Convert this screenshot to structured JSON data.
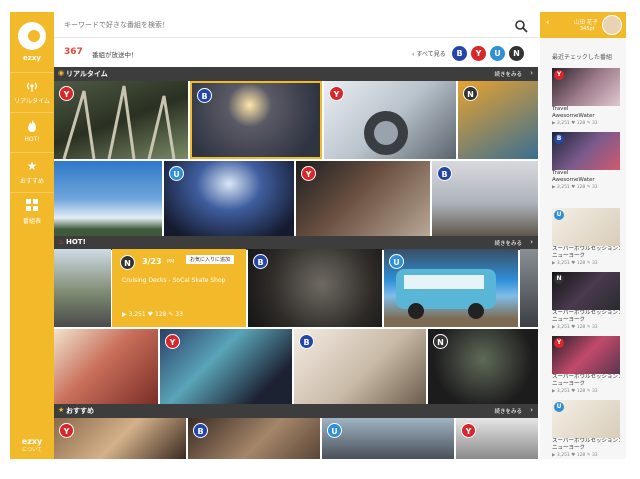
{
  "sidebar": {
    "logo_text": "ezxy",
    "items": [
      {
        "label": "リアルタイム",
        "icon": "broadcast-icon"
      },
      {
        "label": "HOT!",
        "icon": "fire-icon"
      },
      {
        "label": "おすすめ",
        "icon": "star-icon"
      },
      {
        "label": "番組表",
        "icon": "grid-icon"
      }
    ],
    "footer_logo": "ezxy",
    "footer_text": "について"
  },
  "search": {
    "placeholder": "キーワードで好きな番組を検索！"
  },
  "status": {
    "count": "367",
    "count_label": "番組が放送中！",
    "see_all": "すべて見る",
    "channels": [
      {
        "letter": "B",
        "color": "#2446a8"
      },
      {
        "letter": "Y",
        "color": "#d8262a"
      },
      {
        "letter": "U",
        "color": "#2f8fd8"
      },
      {
        "letter": "N",
        "color": "#333333"
      }
    ]
  },
  "sections": {
    "realtime": {
      "title": "リアルタイム",
      "more": "続きをみる"
    },
    "hot": {
      "title": "HOT!",
      "more": "続きをみる"
    },
    "recommend": {
      "title": "おすすめ",
      "more": "続きをみる"
    }
  },
  "feature": {
    "channel": "N",
    "date": "3/23",
    "time": "PM",
    "fav_label": "お気に入りに追加",
    "title": "Cruising Decks - SoCal Skate Shop",
    "views": "3,251",
    "likes": "128",
    "comments": "33"
  },
  "colors": {
    "accent": "#f2b92a",
    "dark": "#3d3d3d",
    "count_red": "#e8463f"
  },
  "right_panel": {
    "user_name": "山田 花子",
    "user_points": "345pt",
    "section_title": "最近チェックした番組",
    "items": [
      {
        "channel": "Y",
        "title": "Travel",
        "subtitle": "AwesomeWater",
        "views": "3,251",
        "likes": "128",
        "comments": "33"
      },
      {
        "channel": "B",
        "title": "Travel",
        "subtitle": "AwesomeWater",
        "views": "3,251",
        "likes": "128",
        "comments": "33"
      },
      {
        "channel": "U",
        "title": "スーパーボウルセッション：",
        "subtitle": "ニューヨーク",
        "views": "3,251",
        "likes": "128",
        "comments": "33"
      },
      {
        "channel": "N",
        "title": "スーパーボウルセッション：",
        "subtitle": "ニューヨーク",
        "views": "3,251",
        "likes": "128",
        "comments": "33"
      },
      {
        "channel": "Y",
        "title": "スーパーボウルセッション：",
        "subtitle": "ニューヨーク",
        "views": "3,251",
        "likes": "128",
        "comments": "33"
      },
      {
        "channel": "U",
        "title": "スーパーボウルセッション：",
        "subtitle": "ニューヨーク",
        "views": "3,251",
        "likes": "128",
        "comments": "33"
      }
    ]
  }
}
